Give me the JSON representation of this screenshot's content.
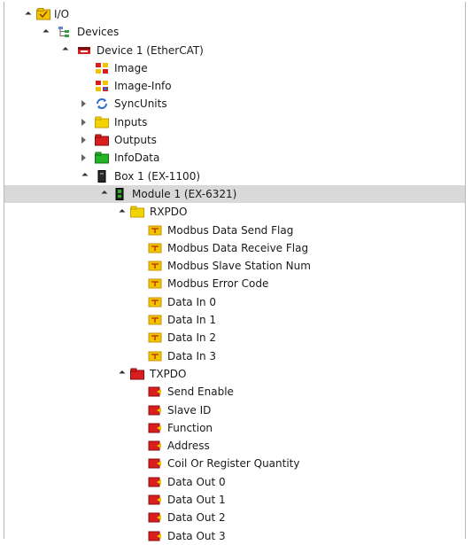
{
  "tree": {
    "nodes": [
      {
        "label": "I/O",
        "level": 0,
        "expander": "open",
        "icon": "io-folder-icon"
      },
      {
        "label": "Devices",
        "level": 1,
        "expander": "open",
        "icon": "devices-tree-icon"
      },
      {
        "label": "Device 1 (EtherCAT)",
        "level": 2,
        "expander": "open",
        "icon": "ethercat-device-icon"
      },
      {
        "label": "Image",
        "level": 3,
        "expander": "none",
        "icon": "image-icon"
      },
      {
        "label": "Image-Info",
        "level": 3,
        "expander": "none",
        "icon": "image-info-icon"
      },
      {
        "label": "SyncUnits",
        "level": 3,
        "expander": "closed",
        "icon": "sync-units-icon"
      },
      {
        "label": "Inputs",
        "level": 3,
        "expander": "closed",
        "icon": "inputs-folder-icon"
      },
      {
        "label": "Outputs",
        "level": 3,
        "expander": "closed",
        "icon": "outputs-folder-icon"
      },
      {
        "label": "InfoData",
        "level": 3,
        "expander": "closed",
        "icon": "infodata-folder-icon"
      },
      {
        "label": "Box 1 (EX-1100)",
        "level": 3,
        "expander": "open",
        "icon": "box-icon"
      },
      {
        "label": "Module 1 (EX-6321)",
        "level": 4,
        "expander": "open",
        "icon": "module-icon",
        "selected": true
      },
      {
        "label": "RXPDO",
        "level": 5,
        "expander": "open",
        "icon": "rxpdo-folder-icon"
      },
      {
        "label": "Modbus Data Send Flag",
        "level": 6,
        "expander": "none",
        "icon": "input-variable-icon"
      },
      {
        "label": "Modbus Data Receive Flag",
        "level": 6,
        "expander": "none",
        "icon": "input-variable-icon"
      },
      {
        "label": "Modbus Slave Station Num",
        "level": 6,
        "expander": "none",
        "icon": "input-variable-icon"
      },
      {
        "label": "Modbus Error Code",
        "level": 6,
        "expander": "none",
        "icon": "input-variable-icon"
      },
      {
        "label": "Data In 0",
        "level": 6,
        "expander": "none",
        "icon": "input-variable-icon"
      },
      {
        "label": "Data In 1",
        "level": 6,
        "expander": "none",
        "icon": "input-variable-icon"
      },
      {
        "label": "Data In 2",
        "level": 6,
        "expander": "none",
        "icon": "input-variable-icon"
      },
      {
        "label": "Data In 3",
        "level": 6,
        "expander": "none",
        "icon": "input-variable-icon"
      },
      {
        "label": "TXPDO",
        "level": 5,
        "expander": "open",
        "icon": "txpdo-folder-icon"
      },
      {
        "label": "Send Enable",
        "level": 6,
        "expander": "none",
        "icon": "output-variable-icon"
      },
      {
        "label": "Slave ID",
        "level": 6,
        "expander": "none",
        "icon": "output-variable-icon"
      },
      {
        "label": "Function",
        "level": 6,
        "expander": "none",
        "icon": "output-variable-icon"
      },
      {
        "label": "Address",
        "level": 6,
        "expander": "none",
        "icon": "output-variable-icon"
      },
      {
        "label": "Coil Or Register Quantity",
        "level": 6,
        "expander": "none",
        "icon": "output-variable-icon"
      },
      {
        "label": "Data Out 0",
        "level": 6,
        "expander": "none",
        "icon": "output-variable-icon"
      },
      {
        "label": "Data Out 1",
        "level": 6,
        "expander": "none",
        "icon": "output-variable-icon"
      },
      {
        "label": "Data Out 2",
        "level": 6,
        "expander": "none",
        "icon": "output-variable-icon"
      },
      {
        "label": "Data Out 3",
        "level": 6,
        "expander": "none",
        "icon": "output-variable-icon"
      }
    ]
  },
  "colors": {
    "selected_row": "#d9d9d9",
    "folder_yellow": "#f2c400",
    "output_red": "#d81e1e",
    "infodata_green": "#23b323"
  }
}
